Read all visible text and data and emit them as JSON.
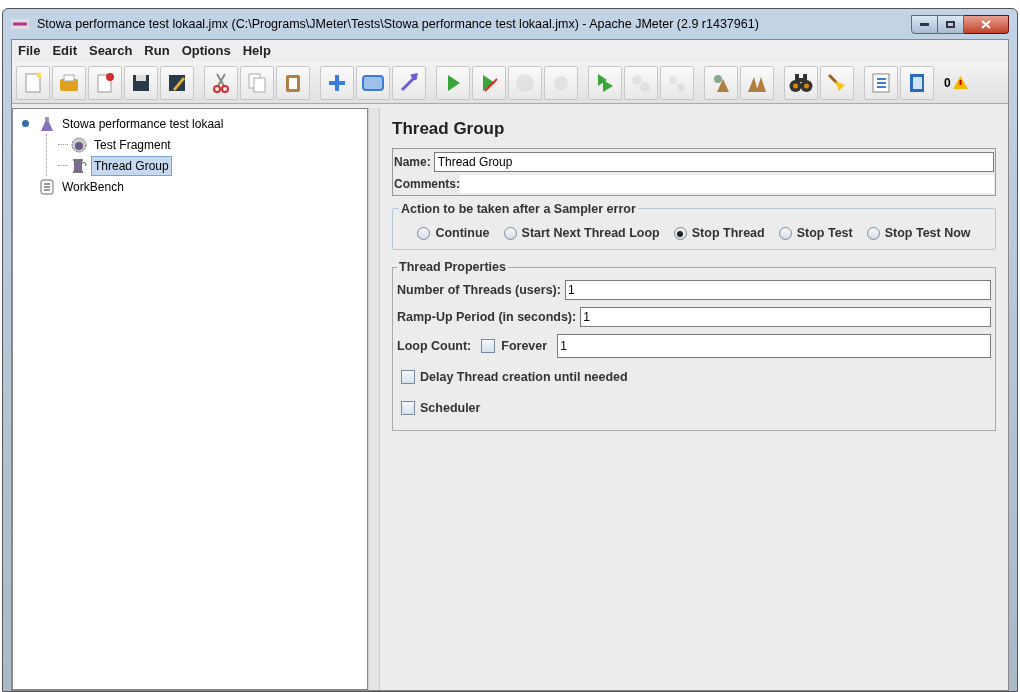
{
  "window": {
    "title": "Stowa performance test lokaal.jmx (C:\\Programs\\JMeter\\Tests\\Stowa performance test lokaal.jmx) - Apache JMeter (2.9 r1437961)"
  },
  "menu": [
    {
      "label": "File"
    },
    {
      "label": "Edit"
    },
    {
      "label": "Search"
    },
    {
      "label": "Run"
    },
    {
      "label": "Options"
    },
    {
      "label": "Help"
    }
  ],
  "toolbar": [
    [
      {
        "kind": "new",
        "disabled": false
      },
      {
        "kind": "open",
        "disabled": false
      },
      {
        "kind": "close",
        "disabled": false
      },
      {
        "kind": "save",
        "disabled": false
      },
      {
        "kind": "saveas",
        "disabled": false
      }
    ],
    [
      {
        "kind": "cut",
        "disabled": false
      },
      {
        "kind": "copy",
        "disabled": false
      },
      {
        "kind": "paste",
        "disabled": false
      }
    ],
    [
      {
        "kind": "expand",
        "disabled": false
      },
      {
        "kind": "collapse",
        "disabled": false
      },
      {
        "kind": "toggle",
        "disabled": false
      }
    ],
    [
      {
        "kind": "start",
        "disabled": false
      },
      {
        "kind": "startnotimers",
        "disabled": false
      },
      {
        "kind": "stop",
        "disabled": true
      },
      {
        "kind": "shutdown",
        "disabled": true
      }
    ],
    [
      {
        "kind": "remotestart",
        "disabled": false
      },
      {
        "kind": "remotestop",
        "disabled": true
      },
      {
        "kind": "remoteshutdown",
        "disabled": true
      }
    ],
    [
      {
        "kind": "clear",
        "disabled": false
      },
      {
        "kind": "clearall",
        "disabled": false
      }
    ],
    [
      {
        "kind": "search",
        "disabled": false
      },
      {
        "kind": "reset",
        "disabled": false
      }
    ],
    [
      {
        "kind": "functions",
        "disabled": false
      },
      {
        "kind": "help",
        "disabled": false
      }
    ]
  ],
  "warning_count": "0",
  "tree": [
    {
      "label": "Stowa performance test lokaal",
      "kind": "testplan",
      "expanded": true,
      "selected": false,
      "children": [
        {
          "label": "Test Fragment",
          "kind": "fragment",
          "selected": false
        },
        {
          "label": "Thread Group",
          "kind": "threadgroup",
          "selected": true
        }
      ]
    },
    {
      "label": "WorkBench",
      "kind": "workbench",
      "selected": false
    }
  ],
  "panel": {
    "title": "Thread Group",
    "name_label": "Name:",
    "name_value": "Thread Group",
    "comments_label": "Comments:",
    "error_action": {
      "legend": "Action to be taken after a Sampler error",
      "options": [
        {
          "label": "Continue",
          "selected": false
        },
        {
          "label": "Start Next Thread Loop",
          "selected": false
        },
        {
          "label": "Stop Thread",
          "selected": true
        },
        {
          "label": "Stop Test",
          "selected": false
        },
        {
          "label": "Stop Test Now",
          "selected": false
        }
      ]
    },
    "thread_properties": {
      "legend": "Thread Properties",
      "threads_label": "Number of Threads (users):",
      "threads_value": "1",
      "rampup_label": "Ramp-Up Period (in seconds):",
      "rampup_value": "1",
      "loop_label": "Loop Count:",
      "forever": {
        "label": "Forever",
        "checked": false
      },
      "loop_value": "1",
      "delay": {
        "label": "Delay Thread creation until needed",
        "checked": false
      },
      "scheduler": {
        "label": "Scheduler",
        "checked": false
      }
    }
  }
}
